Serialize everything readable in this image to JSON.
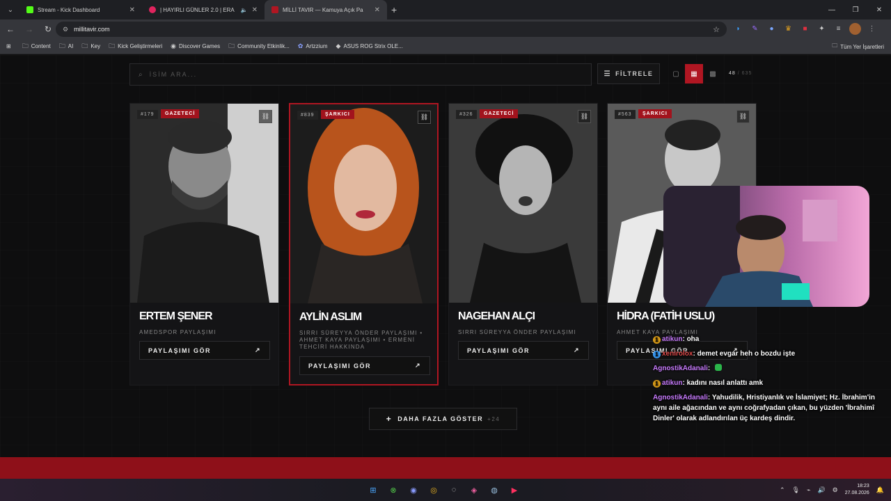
{
  "browser": {
    "tabs": [
      {
        "title": "Stream - Kick Dashboard",
        "favicon_color": "#53fc18",
        "active": false
      },
      {
        "title": "| HAYIRLI GÜNLER 2.0 | ERA",
        "favicon_color": "#e0245e",
        "active": false
      },
      {
        "title": "MİLLİ TAVIR — Kamuya Açık Pa",
        "favicon_color": "#b01622",
        "active": true
      }
    ],
    "url": "millitavir.com",
    "bookmarks": [
      "Content",
      "AI",
      "Key",
      "Kick Geliştirmeleri",
      "Discover Games",
      "Community Etkinlik...",
      "Artzzium",
      "ASUS ROG Strix OLE..."
    ],
    "bookmarks_right": "Tüm Yer İşaretleri"
  },
  "toolbar": {
    "search_placeholder": "İSİM ARA...",
    "filter_label": "FİLTRELE",
    "count_shown": "48",
    "count_sep": "/",
    "count_total": "635"
  },
  "cards": [
    {
      "number": "#179",
      "role": "GAZETECİ",
      "name": "ERTEM ŞENER",
      "desc": "AMEDSPOR PAYLAŞIMI",
      "button": "PAYLAŞIMI GÖR"
    },
    {
      "number": "#839",
      "role": "ŞARKICI",
      "name": "AYLİN ASLIM",
      "desc": "SIRRI SÜREYYA ÖNDER PAYLAŞIMI • AHMET KAYA PAYLAŞIMI • ERMENİ TEHCİRİ HAKKINDA",
      "button": "PAYLAŞIMI GÖR"
    },
    {
      "number": "#326",
      "role": "GAZETECİ",
      "name": "NAGEHAN ALÇI",
      "desc": "SIRRI SÜREYYA ÖNDER PAYLAŞIMI",
      "button": "PAYLAŞIMI GÖR"
    },
    {
      "number": "#563",
      "role": "ŞARKICI",
      "name": "HİDRA (FATİH USLU)",
      "desc": "AHMET KAYA PAYLAŞIMI",
      "button": "PAYLAŞIMI GÖR"
    }
  ],
  "more": {
    "label": "DAHA FAZLA GÖSTER",
    "extra": "+24"
  },
  "chat": [
    {
      "user": "atikun",
      "text": "oha"
    },
    {
      "user": "xenirolox",
      "text": "demet evgar heh o bozdu işte"
    },
    {
      "user": "AgnostikAdanali",
      "text": ""
    },
    {
      "user": "atikun",
      "text": "kadını nasıl anlattı amk"
    },
    {
      "user": "AgnostikAdanali",
      "text": "Yahudilik, Hristiyanlık ve İslamiyet; Hz. İbrahim'in aynı aile ağacından ve aynı coğrafyadan çıkan, bu yüzden 'İbrahimî Dinler' olarak adlandırılan üç kardeş dindir."
    }
  ],
  "taskbar": {
    "time": "18:23",
    "date": "27.08.2026"
  }
}
